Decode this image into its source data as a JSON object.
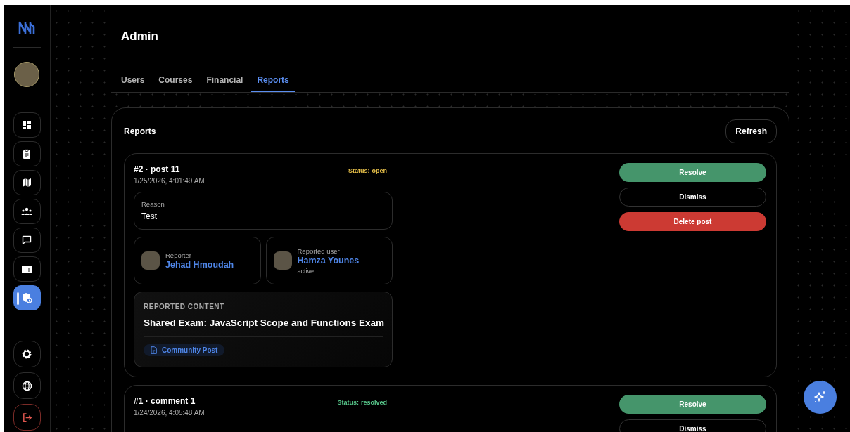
{
  "sidebar": {
    "items": [
      {
        "selected": false
      },
      {
        "selected": false
      },
      {
        "selected": false
      },
      {
        "selected": false
      },
      {
        "selected": false
      },
      {
        "selected": false
      },
      {
        "selected": true
      }
    ],
    "bottom_items": [
      {
        "kind": "normal"
      },
      {
        "kind": "normal"
      },
      {
        "kind": "danger"
      }
    ]
  },
  "page": {
    "title": "Admin"
  },
  "tabs": [
    {
      "label": "Users",
      "selected": false
    },
    {
      "label": "Courses",
      "selected": false
    },
    {
      "label": "Financial",
      "selected": false
    },
    {
      "label": "Reports",
      "selected": true
    }
  ],
  "panel": {
    "title": "Reports",
    "refresh_button": "Refresh"
  },
  "reports": [
    {
      "title": "#2 · post 11",
      "date": "1/25/2026, 4:01:49 AM",
      "status_prefix": "Status:",
      "status": "open",
      "reason_label": "Reason",
      "reason": "Test",
      "reporter": {
        "label": "Reporter",
        "name": "Jehad Hmoudah"
      },
      "reported_user": {
        "label": "Reported user",
        "name": "Hamza Younes",
        "state": "active"
      },
      "content": {
        "heading": "REPORTED CONTENT",
        "title": "Shared Exam: JavaScript Scope and Functions Exam",
        "tag": "Community Post"
      },
      "actions": [
        {
          "label": "Resolve",
          "kind": "success"
        },
        {
          "label": "Dismiss",
          "kind": "outline"
        },
        {
          "label": "Delete post",
          "kind": "danger"
        }
      ]
    },
    {
      "title": "#1 · comment 1",
      "date": "1/24/2026, 4:05:48 AM",
      "status_prefix": "Status:",
      "status": "resolved",
      "actions": [
        {
          "label": "Resolve",
          "kind": "success"
        },
        {
          "label": "Dismiss",
          "kind": "outline"
        }
      ]
    }
  ]
}
